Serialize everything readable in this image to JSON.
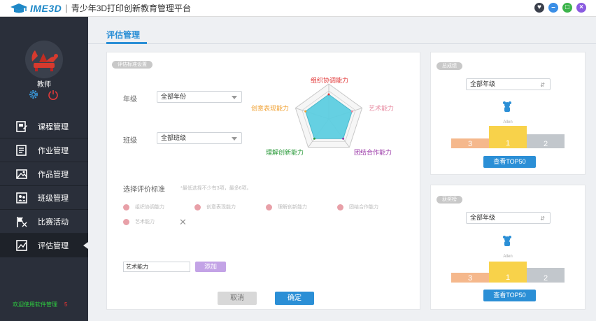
{
  "app": {
    "logo_text": "IME3D",
    "title": "青少年3D打印创新教育管理平台"
  },
  "window_buttons": [
    {
      "name": "shirt",
      "color": "#3a3f4b"
    },
    {
      "name": "minimize",
      "color": "#3a8ee6"
    },
    {
      "name": "maximize",
      "color": "#3cb44b"
    },
    {
      "name": "close",
      "color": "#8a5be0"
    }
  ],
  "user": {
    "role": "教师"
  },
  "nav": [
    {
      "label": "课程管理",
      "icon": "course-icon"
    },
    {
      "label": "作业管理",
      "icon": "homework-icon"
    },
    {
      "label": "作品管理",
      "icon": "works-icon"
    },
    {
      "label": "班级管理",
      "icon": "class-icon"
    },
    {
      "label": "比赛活动",
      "icon": "flag-icon"
    },
    {
      "label": "评估管理",
      "icon": "chart-icon",
      "active": true
    }
  ],
  "sidebar_footer": {
    "text": "欢迎使用软件管理",
    "count": "5"
  },
  "page": {
    "title": "评估管理"
  },
  "eval": {
    "section_chip": "评估标准设置",
    "grade_label": "年级",
    "grade_value": "全部年份",
    "class_label": "班级",
    "class_value": "全部班级",
    "radar_labels": {
      "top": "组织协调能力",
      "right": "艺术能力",
      "bottom_right": "团结合作能力",
      "bottom_left": "理解创新能力",
      "left": "创意表现能力"
    },
    "criteria_title": "选择评价标准",
    "criteria_hint": "*最低选择不少有3项，最多6项。",
    "criteria": [
      "组织协调能力",
      "创意表现能力",
      "理解创新能力",
      "团结合作能力",
      "艺术能力"
    ],
    "new_criterion_value": "艺术能力",
    "add_label": "添加",
    "cancel_label": "取消",
    "confirm_label": "确定"
  },
  "rank1": {
    "chip": "总成绩",
    "select_value": "全部年级",
    "winner": "Allen",
    "places": [
      "3",
      "1",
      "2"
    ],
    "button": "查看TOP50"
  },
  "rank2": {
    "chip": "获奖榜",
    "select_value": "全部年级",
    "winner": "Allen",
    "places": [
      "3",
      "1",
      "2"
    ],
    "button": "查看TOP50"
  },
  "colors": {
    "accent": "#2b8fd6",
    "sidebar": "#2a2f3a",
    "gold": "#f8d24a",
    "silver": "#c2c7cc",
    "bronze": "#f5b88c",
    "radar_fill": "#5dcde0"
  }
}
